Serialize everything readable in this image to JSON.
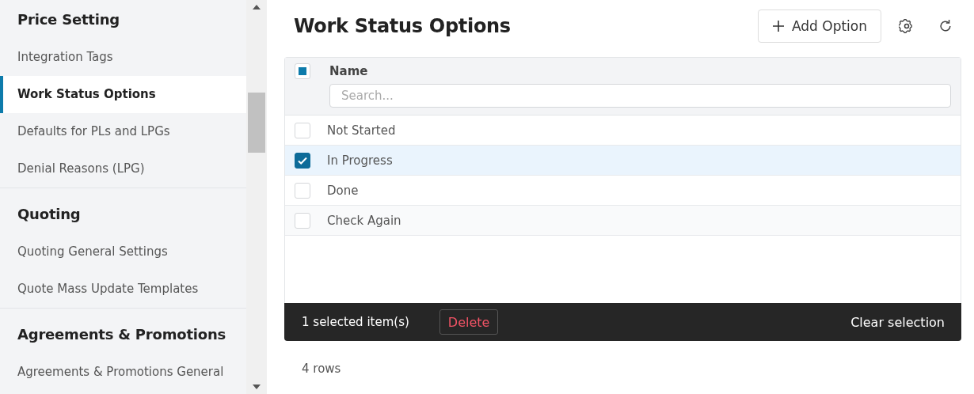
{
  "sidebar": {
    "sections": [
      {
        "heading": "Price Setting",
        "items": [
          {
            "label": "Integration Tags",
            "selected": false
          },
          {
            "label": "Work Status Options",
            "selected": true
          },
          {
            "label": "Defaults for PLs and LPGs",
            "selected": false
          },
          {
            "label": "Denial Reasons (LPG)",
            "selected": false
          }
        ]
      },
      {
        "heading": "Quoting",
        "items": [
          {
            "label": "Quoting General Settings",
            "selected": false
          },
          {
            "label": "Quote Mass Update Templates",
            "selected": false
          }
        ]
      },
      {
        "heading": "Agreements & Promotions",
        "items": [
          {
            "label": "Agreements & Promotions General",
            "selected": false
          }
        ]
      }
    ]
  },
  "page": {
    "title": "Work Status Options",
    "add_button": "Add Option"
  },
  "table": {
    "header": {
      "indeterminate": true,
      "column": "Name",
      "search_placeholder": "Search..."
    },
    "rows": [
      {
        "name": "Not Started",
        "selected": false
      },
      {
        "name": "In Progress",
        "selected": true
      },
      {
        "name": "Done",
        "selected": false
      },
      {
        "name": "Check Again",
        "selected": false
      }
    ]
  },
  "selection_bar": {
    "count": "1 selected item(s)",
    "delete": "Delete",
    "clear": "Clear selection"
  },
  "footer": {
    "rows": "4 rows"
  }
}
